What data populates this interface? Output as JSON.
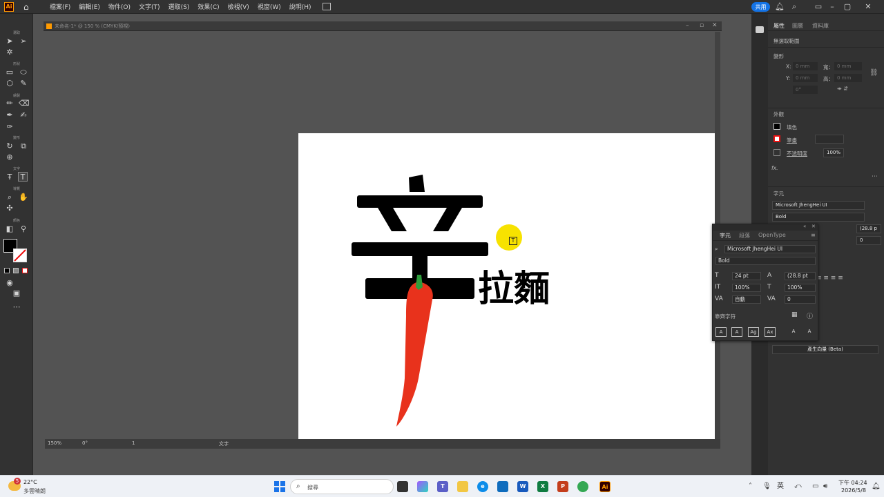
{
  "app": {
    "logo_text": "Ai",
    "menus": [
      "檔案(F)",
      "編輯(E)",
      "物件(O)",
      "文字(T)",
      "選取(S)",
      "效果(C)",
      "檢視(V)",
      "視窗(W)",
      "說明(H)"
    ],
    "share_label": "共用"
  },
  "toolbar": {
    "groups": [
      "選取",
      "形狀",
      "繪製",
      "變形",
      "文字",
      "導覽",
      "顏色"
    ]
  },
  "document": {
    "tab_title": "未命名-1* @ 150 % (CMYK/預視)",
    "zoom": "150%",
    "rotation": "0°",
    "artboard_number": "1",
    "status_tool": "文字"
  },
  "artwork": {
    "big_char": "辛",
    "small_text": "拉麵",
    "carrot_color": "#e8321c",
    "leaf_color": "#2e9d3c"
  },
  "properties": {
    "tabs": [
      "屬性",
      "圖層",
      "資料庫"
    ],
    "no_selection": "無選取範圍",
    "transform_title": "變形",
    "x_label": "X:",
    "y_label": "Y:",
    "w_label": "寬：",
    "h_label": "高：",
    "x_value": "0 mm",
    "y_value": "0 mm",
    "w_value": "0 mm",
    "h_value": "0 mm",
    "angle_value": "0°",
    "appearance_title": "外觀",
    "fill_label": "填色",
    "stroke_label": "筆畫",
    "opacity_label": "不透明度",
    "opacity_value": "100%",
    "fx_label": "fx.",
    "char_title": "字元",
    "font_family": "Microsoft JhengHei UI",
    "font_style": "Bold",
    "leading_value": "(28.8 p",
    "tracking_value": "0",
    "generate_button": "產生向量 (Beta)"
  },
  "char_panel": {
    "tabs": [
      "字元",
      "段落",
      "OpenType"
    ],
    "font_family": "Microsoft JhengHei UI",
    "font_style": "Bold",
    "size": "24 pt",
    "leading": "(28.8 pt",
    "vscale": "100%",
    "hscale": "100%",
    "kerning": "自動",
    "tracking": "0",
    "snap_label": "靠齊字符",
    "glyph_buttons": [
      "A",
      "A",
      "Ag",
      "Ax",
      "A",
      "A"
    ]
  },
  "taskbar": {
    "weather_temp": "22°C",
    "weather_desc": "多雲晴朗",
    "weather_badge": "5",
    "search_placeholder": "搜尋",
    "ime": "英",
    "time": "下午 04:24",
    "date": "2026/5/8"
  }
}
